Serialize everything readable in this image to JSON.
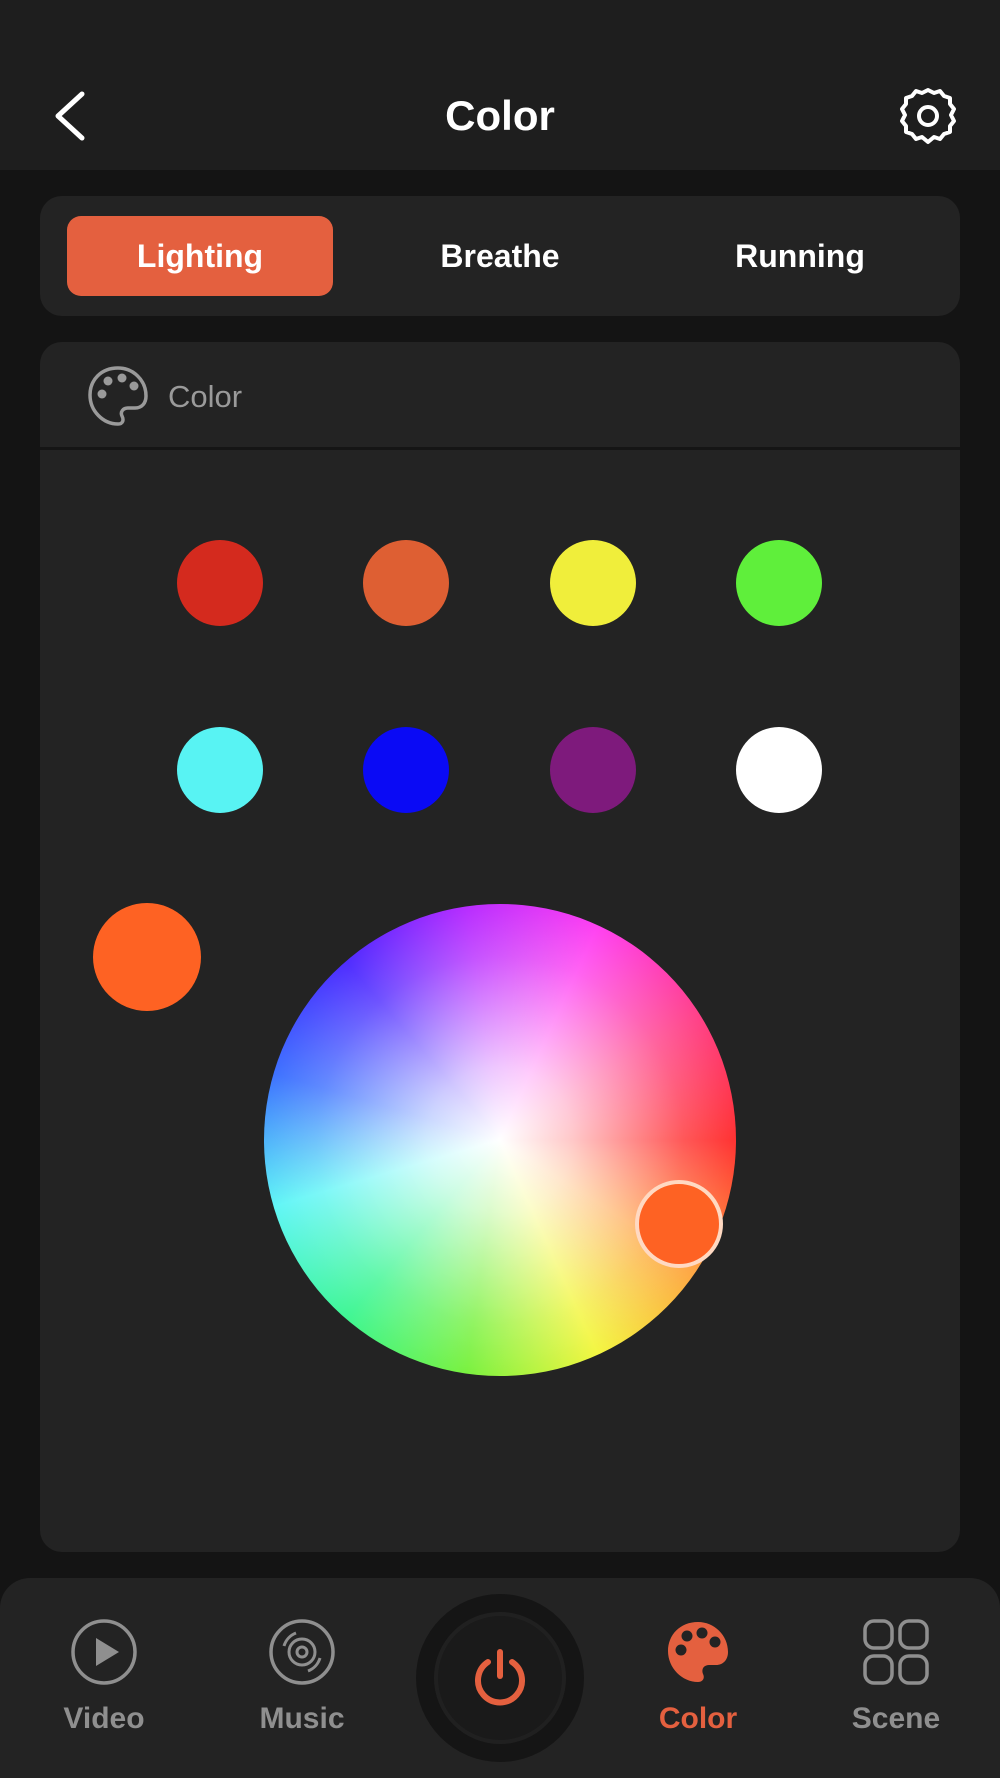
{
  "header": {
    "title": "Color"
  },
  "modes": [
    {
      "label": "Lighting",
      "active": true
    },
    {
      "label": "Breathe",
      "active": false
    },
    {
      "label": "Running",
      "active": false
    }
  ],
  "panel": {
    "title": "Color"
  },
  "presets": {
    "row1": [
      "#d42a1e",
      "#de5f33",
      "#f0ee3b",
      "#5fef3b"
    ],
    "row2": [
      "#58f3f3",
      "#0a0af5",
      "#7e1a7c",
      "#ffffff"
    ]
  },
  "current_color": "#fe6223",
  "accent_color": "#e4603f",
  "nav": [
    {
      "label": "Video",
      "icon": "play-circle-icon",
      "active": false
    },
    {
      "label": "Music",
      "icon": "disc-icon",
      "active": false
    },
    {
      "label": "",
      "icon": "power-icon",
      "active": false
    },
    {
      "label": "Color",
      "icon": "palette-icon",
      "active": true
    },
    {
      "label": "Scene",
      "icon": "grid-icon",
      "active": false
    }
  ]
}
